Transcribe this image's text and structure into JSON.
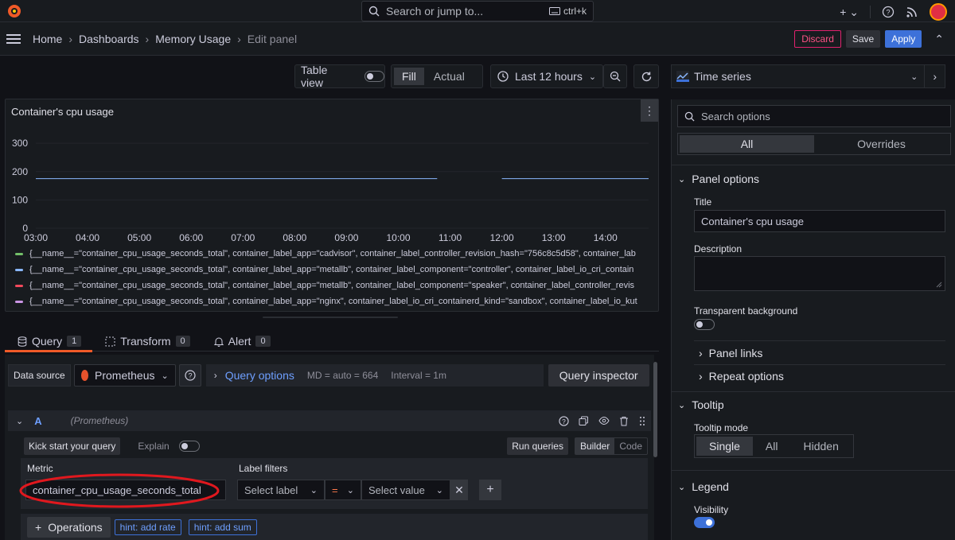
{
  "topbar": {
    "search_placeholder": "Search or jump to...",
    "shortcut": "ctrl+k"
  },
  "breadcrumb": [
    "Home",
    "Dashboards",
    "Memory Usage",
    "Edit panel"
  ],
  "actions": {
    "discard": "Discard",
    "save": "Save",
    "apply": "Apply"
  },
  "viewbar": {
    "table_view": "Table view",
    "fill": "Fill",
    "actual": "Actual",
    "time_range": "Last 12 hours"
  },
  "panel": {
    "title": "Container's cpu usage",
    "y_ticks": [
      "300",
      "200",
      "100",
      "0"
    ],
    "x_ticks": [
      "03:00",
      "04:00",
      "05:00",
      "06:00",
      "07:00",
      "08:00",
      "09:00",
      "10:00",
      "11:00",
      "12:00",
      "13:00",
      "14:00"
    ],
    "legend": [
      {
        "color": "#73bf69",
        "text": "{__name__=\"container_cpu_usage_seconds_total\", container_label_app=\"cadvisor\", container_label_controller_revision_hash=\"756c8c5d58\", container_lab"
      },
      {
        "color": "#8ab8ff",
        "text": "{__name__=\"container_cpu_usage_seconds_total\", container_label_app=\"metallb\", container_label_component=\"controller\", container_label_io_cri_contain"
      },
      {
        "color": "#f2495c",
        "text": "{__name__=\"container_cpu_usage_seconds_total\", container_label_app=\"metallb\", container_label_component=\"speaker\", container_label_controller_revis"
      },
      {
        "color": "#ca95e5",
        "text": "{__name__=\"container_cpu_usage_seconds_total\", container_label_app=\"nginx\", container_label_io_cri_containerd_kind=\"sandbox\", container_label_io_kut"
      }
    ]
  },
  "chart_data": {
    "type": "line",
    "x": [
      "03:00",
      "04:00",
      "05:00",
      "06:00",
      "07:00",
      "08:00",
      "09:00",
      "10:00",
      "10:45",
      "11:00",
      "12:00",
      "13:00",
      "14:00",
      "14:50"
    ],
    "series": [
      {
        "values": [
          175,
          175,
          175,
          175,
          175,
          175,
          175,
          175,
          175,
          null,
          175,
          175,
          175,
          175
        ]
      }
    ],
    "ylim": [
      0,
      320
    ],
    "yticks": [
      0,
      100,
      200,
      300
    ],
    "grid": true,
    "legend_position": "bottom"
  },
  "query_tabs": [
    {
      "label": "Query",
      "count": "1"
    },
    {
      "label": "Transform",
      "count": "0"
    },
    {
      "label": "Alert",
      "count": "0"
    }
  ],
  "datasource": {
    "label": "Data source",
    "value": "Prometheus",
    "query_options": "Query options",
    "md": "MD = auto = 664",
    "interval": "Interval = 1m",
    "inspector": "Query inspector"
  },
  "query": {
    "ref": "A",
    "ds_name": "(Prometheus)",
    "kick_start": "Kick start your query",
    "explain": "Explain",
    "run": "Run queries",
    "builder": "Builder",
    "code": "Code",
    "metric_label": "Metric",
    "metric_value": "container_cpu_usage_seconds_total",
    "label_filters": "Label filters",
    "select_label": "Select label",
    "op": "=",
    "select_value": "Select value",
    "operations": "Operations",
    "hint1": "hint: add rate",
    "hint2": "hint: add sum"
  },
  "options": {
    "viz": "Time series",
    "search_placeholder": "Search options",
    "tab_all": "All",
    "tab_overrides": "Overrides",
    "panel_options": "Panel options",
    "title_label": "Title",
    "title_value": "Container's cpu usage",
    "description_label": "Description",
    "transparent_label": "Transparent background",
    "panel_links": "Panel links",
    "repeat_options": "Repeat options",
    "tooltip": "Tooltip",
    "tooltip_mode": "Tooltip mode",
    "modes": [
      "Single",
      "All",
      "Hidden"
    ],
    "legend": "Legend",
    "visibility": "Visibility"
  }
}
